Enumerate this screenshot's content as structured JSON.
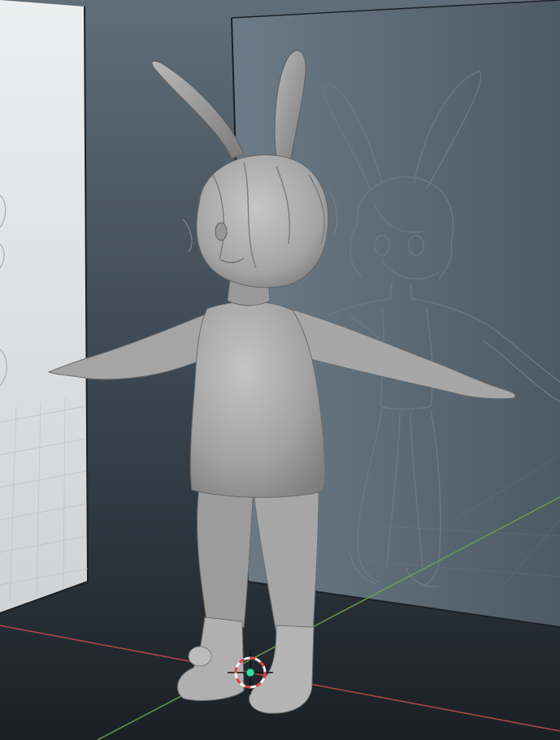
{
  "app": {
    "view": "3d-viewport",
    "shading": "solid-matcap-gray"
  },
  "scene": {
    "objects": [
      {
        "name": "bunny-character",
        "type": "sculpted-mesh"
      },
      {
        "name": "reference-plane-front",
        "type": "image-plane"
      },
      {
        "name": "reference-plane-side",
        "type": "image-plane"
      }
    ],
    "axes": {
      "x_color": "#c24a4a",
      "y_color": "#6aa34a"
    },
    "cursor": {
      "name": "3d-cursor",
      "ring_colors": [
        "#e23c3c",
        "#f2f2f2"
      ],
      "origin_color": "#31e0a0"
    }
  },
  "colors": {
    "background_top": "#5d6c77",
    "background_bottom": "#1b2126",
    "model": "#a9a9a9",
    "sketch_lines": "#6e7881",
    "left_plane": "#dfe2e4"
  }
}
